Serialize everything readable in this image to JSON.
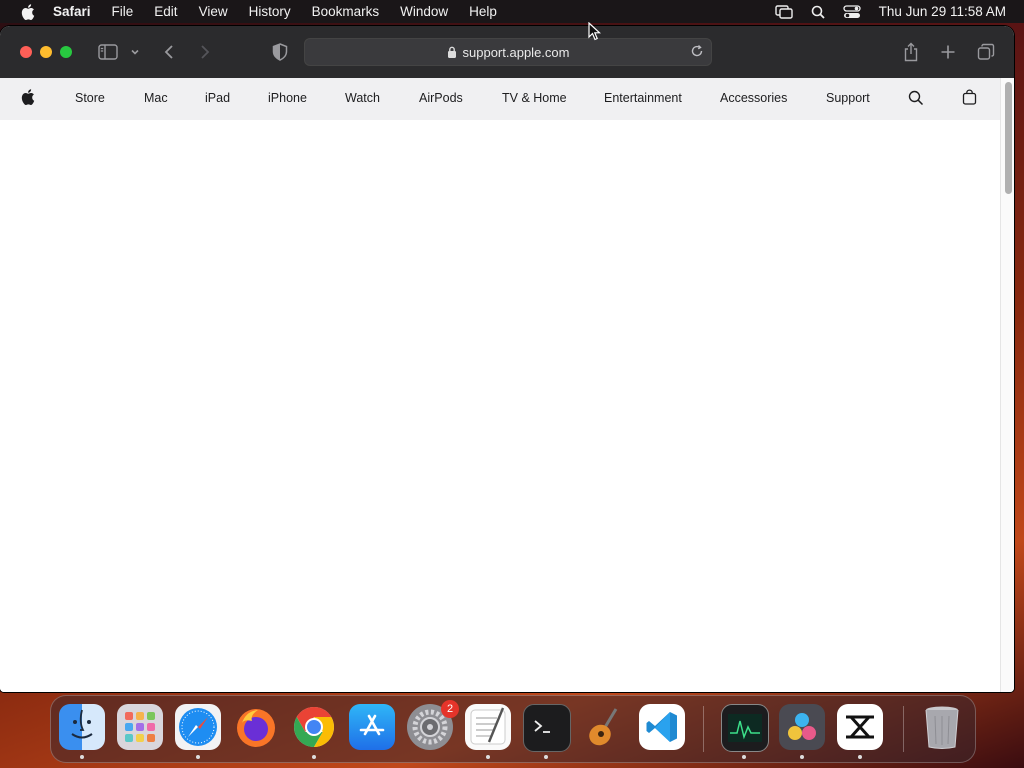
{
  "menubar": {
    "app_name": "Safari",
    "items": [
      "File",
      "Edit",
      "View",
      "History",
      "Bookmarks",
      "Window",
      "Help"
    ],
    "clock": "Thu Jun 29  11:58 AM"
  },
  "browser": {
    "url": "support.apple.com"
  },
  "globalnav": {
    "items": [
      "Store",
      "Mac",
      "iPad",
      "iPhone",
      "Watch",
      "AirPods",
      "TV & Home",
      "Entertainment",
      "Accessories",
      "Support"
    ]
  },
  "dock": {
    "apps": [
      "Finder",
      "Launchpad",
      "Safari",
      "Firefox",
      "Chrome",
      "App Store",
      "System Settings",
      "TextEdit",
      "Terminal",
      "GarageBand",
      "Visual Studio Code",
      "Activity Monitor",
      "DaVinci Resolve",
      "CapCut",
      "Trash"
    ],
    "settings_badge": "2"
  },
  "colors": {
    "menubar_bg": "#1a1618",
    "toolbar_bg": "#2b2b2d",
    "nav_bg": "#f0f0f2"
  }
}
